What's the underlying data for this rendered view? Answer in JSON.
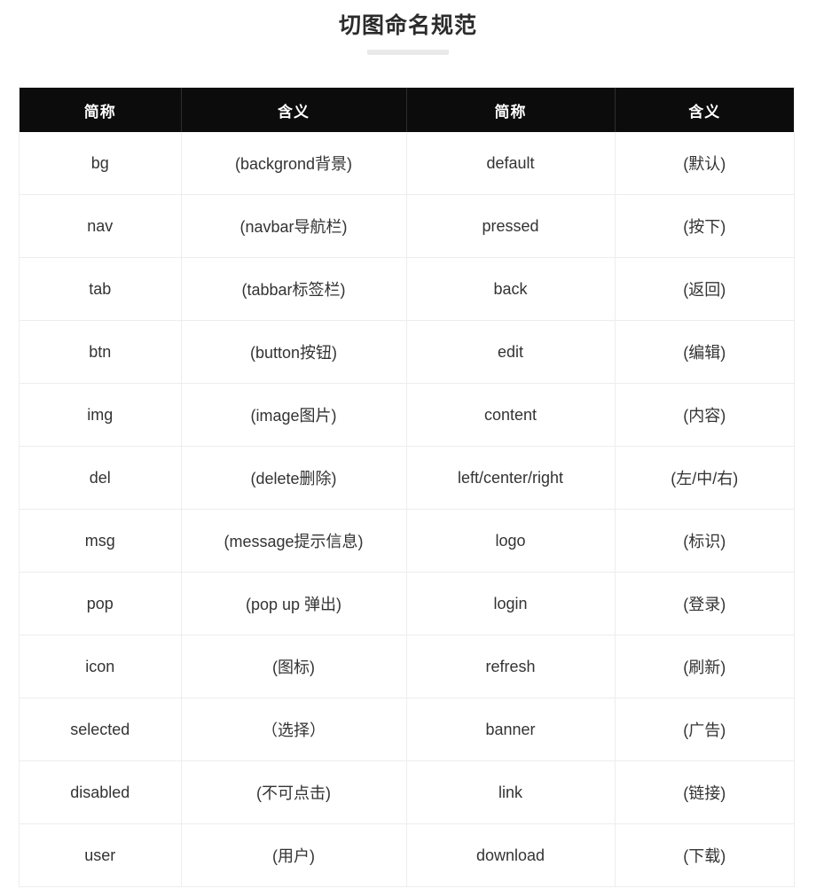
{
  "header": {
    "title": "切图命名规范",
    "underline_color": "#e9e9e9"
  },
  "table": {
    "header_bg": "#0c0c0c",
    "header_text_color": "#ffffff",
    "border_color": "#ededed",
    "columns": [
      "简称",
      "含义",
      "简称",
      "含义"
    ],
    "rows": [
      {
        "abbr_left": "bg",
        "mean_left": "(backgrond背景)",
        "abbr_right": "default",
        "mean_right": "(默认)"
      },
      {
        "abbr_left": "nav",
        "mean_left": "(navbar导航栏)",
        "abbr_right": "pressed",
        "mean_right": "(按下)"
      },
      {
        "abbr_left": "tab",
        "mean_left": "(tabbar标签栏)",
        "abbr_right": "back",
        "mean_right": "(返回)"
      },
      {
        "abbr_left": "btn",
        "mean_left": "(button按钮)",
        "abbr_right": "edit",
        "mean_right": "(编辑)"
      },
      {
        "abbr_left": "img",
        "mean_left": "(image图片)",
        "abbr_right": "content",
        "mean_right": "(内容)"
      },
      {
        "abbr_left": "del",
        "mean_left": "(delete删除)",
        "abbr_right": "left/center/right",
        "mean_right": "(左/中/右)"
      },
      {
        "abbr_left": "msg",
        "mean_left": "(message提示信息)",
        "abbr_right": "logo",
        "mean_right": "(标识)"
      },
      {
        "abbr_left": "pop",
        "mean_left": "(pop up 弹出)",
        "abbr_right": "login",
        "mean_right": "(登录)"
      },
      {
        "abbr_left": "icon",
        "mean_left": "(图标)",
        "abbr_right": "refresh",
        "mean_right": "(刷新)"
      },
      {
        "abbr_left": "selected",
        "mean_left": "（选择）",
        "abbr_right": "banner",
        "mean_right": "(广告)"
      },
      {
        "abbr_left": "disabled",
        "mean_left": "(不可点击)",
        "abbr_right": "link",
        "mean_right": "(链接)"
      },
      {
        "abbr_left": "user",
        "mean_left": "(用户)",
        "abbr_right": "download",
        "mean_right": "(下载)"
      }
    ]
  }
}
